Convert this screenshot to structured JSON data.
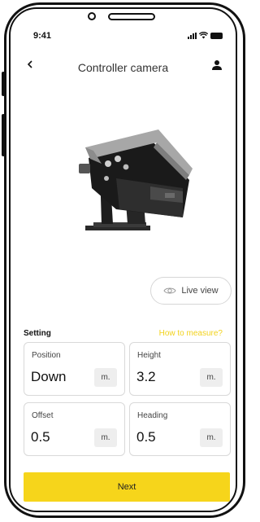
{
  "status_bar": {
    "time": "9:41"
  },
  "header": {
    "title": "Controller camera"
  },
  "icons": {
    "back": "chevron-left-icon",
    "user": "user-icon",
    "eye": "eye-icon",
    "signal": "signal-icon",
    "wifi": "wifi-icon",
    "battery": "battery-icon"
  },
  "live_view": {
    "label": "Live view"
  },
  "settings": {
    "label": "Setting",
    "help_link": "How to measure?",
    "fields": [
      {
        "label": "Position",
        "value": "Down",
        "unit": "m."
      },
      {
        "label": "Height",
        "value": "3.2",
        "unit": "m."
      },
      {
        "label": "Offset",
        "value": "0.5",
        "unit": "m."
      },
      {
        "label": "Heading",
        "value": "0.5",
        "unit": "m."
      }
    ]
  },
  "actions": {
    "next_label": "Next"
  },
  "colors": {
    "accent": "#f6d51b",
    "link": "#f2d21c",
    "text": "#222222",
    "border": "#d9d9d9"
  }
}
